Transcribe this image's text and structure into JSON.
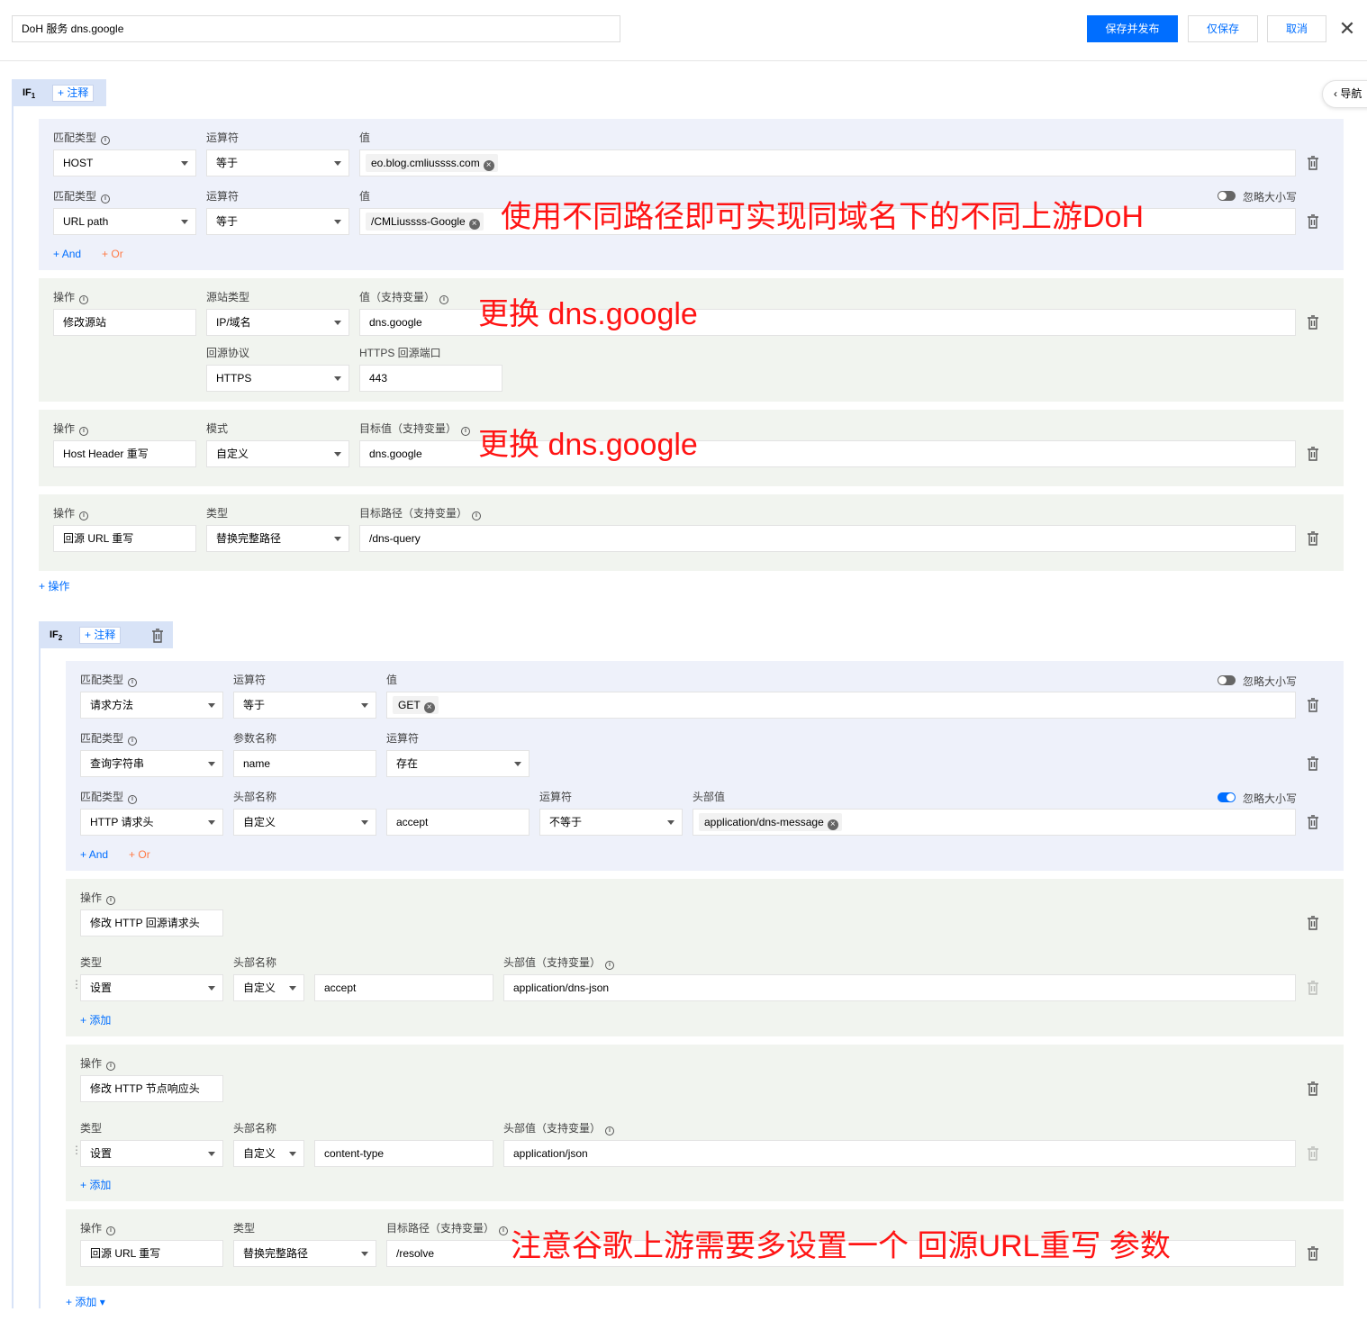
{
  "header": {
    "title_value": "DoH 服务 dns.google",
    "save_publish": "保存并发布",
    "save_only": "仅保存",
    "cancel": "取消",
    "close": "✕"
  },
  "nav": {
    "label": "导航"
  },
  "common": {
    "note_label": "注释",
    "and_label": "And",
    "or_label": "Or",
    "plus": "+"
  },
  "if1": {
    "tag": "IF",
    "tag_sub": "1",
    "conditions": [
      {
        "type_label": "匹配类型",
        "type": "HOST",
        "op_label": "运算符",
        "op": "等于",
        "val_label": "值",
        "value": "eo.blog.cmliussss.com"
      },
      {
        "type_label": "匹配类型",
        "type": "URL path",
        "op_label": "运算符",
        "op": "等于",
        "val_label": "值",
        "value": "/CMLiussss-Google",
        "toggle_label": "忽略大小写",
        "toggle_on": false
      }
    ],
    "actions": [
      {
        "op_label": "操作",
        "op": "修改源站",
        "type_label": "源站类型",
        "type": "IP/域名",
        "val_label": "值（支持变量）",
        "value": "dns.google",
        "proto_label": "回源协议",
        "proto": "HTTPS",
        "port_label": "HTTPS 回源端口",
        "port": "443"
      },
      {
        "op_label": "操作",
        "op": "Host Header 重写",
        "type_label": "模式",
        "type": "自定义",
        "val_label": "目标值（支持变量）",
        "value": "dns.google"
      },
      {
        "op_label": "操作",
        "op": "回源 URL 重写",
        "type_label": "类型",
        "type": "替换完整路径",
        "val_label": "目标路径（支持变量）",
        "value": "/dns-query"
      }
    ],
    "add_action": "操作"
  },
  "if2": {
    "tag": "IF",
    "tag_sub": "2",
    "conditions": [
      {
        "type_label": "匹配类型",
        "type": "请求方法",
        "op_label": "运算符",
        "op": "等于",
        "val_label": "值",
        "value": "GET",
        "toggle_label": "忽略大小写",
        "toggle_on": false
      },
      {
        "type_label": "匹配类型",
        "type": "查询字符串",
        "param_label": "参数名称",
        "param": "name",
        "op_label": "运算符",
        "op": "存在"
      },
      {
        "type_label": "匹配类型",
        "type": "HTTP 请求头",
        "hname_label": "头部名称",
        "hmode": "自定义",
        "hname": "accept",
        "op_label": "运算符",
        "op": "不等于",
        "hval_label": "头部值",
        "value": "application/dns-message",
        "toggle_label": "忽略大小写",
        "toggle_on": true
      }
    ],
    "actions": [
      {
        "op_label": "操作",
        "op": "修改 HTTP 回源请求头",
        "type_label": "类型",
        "type": "设置",
        "hname_label": "头部名称",
        "hmode": "自定义",
        "hname": "accept",
        "hval_label": "头部值（支持变量）",
        "hval": "application/dns-json",
        "add": "添加"
      },
      {
        "op_label": "操作",
        "op": "修改 HTTP 节点响应头",
        "type_label": "类型",
        "type": "设置",
        "hname_label": "头部名称",
        "hmode": "自定义",
        "hname": "content-type",
        "hval_label": "头部值（支持变量）",
        "hval": "application/json",
        "add": "添加"
      },
      {
        "op_label": "操作",
        "op": "回源 URL 重写",
        "type_label": "类型",
        "type": "替换完整路径",
        "val_label": "目标路径（支持变量）",
        "value": "/resolve"
      }
    ],
    "add_label": "添加"
  },
  "annotations": {
    "path_note": "使用不同路径即可实现同域名下的不同上游DoH",
    "replace_note_1": "更换 dns.google",
    "replace_note_2": "更换 dns.google",
    "rewrite_note": "注意谷歌上游需要多设置一个 回源URL重写 参数"
  },
  "colors": {
    "primary": "#006eff",
    "annotation": "#ff1414",
    "or_link": "#ff7a45"
  }
}
